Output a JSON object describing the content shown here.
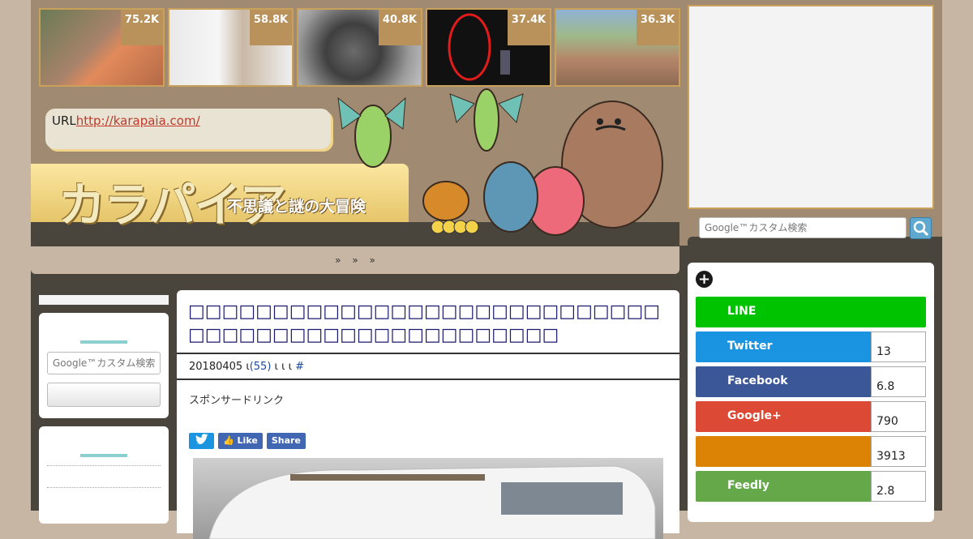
{
  "colors": {
    "twitter": "#1a93e0",
    "facebook": "#3b5797",
    "googleplus": "#dc4a36",
    "hatena": "#dc8205",
    "feedly": "#65a84a",
    "line": "#00c300",
    "title": "#1a1a6e"
  },
  "thumbs": [
    {
      "count": "75.2K"
    },
    {
      "count": "58.8K"
    },
    {
      "count": "40.8K"
    },
    {
      "count": "37.4K"
    },
    {
      "count": "36.3K"
    }
  ],
  "header": {
    "url_label": "URL",
    "url_link": "http://karapaia.com/",
    "logo_text": "カラパイア",
    "logo_sub": "不思議と謎の大冒険"
  },
  "nav": {
    "text": "» » »"
  },
  "search": {
    "placeholder": "Google™カスタム検索"
  },
  "article": {
    "title": "□□□□□□□□□□□□□□□□□□□□□□□□□□□□□□□□□□□□□□□□□□□□□□□□□□",
    "date": "20180405",
    "meta_a": "ι",
    "comments": "(55)",
    "meta_b": "ι ι ι",
    "hash": "#",
    "sponsor": "スポンサードリンク",
    "share_tweet": "",
    "share_like": "Like",
    "share_share": "Share"
  },
  "right_share": [
    {
      "name": "LINE",
      "count": ""
    },
    {
      "name": "Twitter",
      "count": "13"
    },
    {
      "name": "Facebook",
      "count": "6.8"
    },
    {
      "name": "Google+",
      "count": "790"
    },
    {
      "name": "",
      "count": "3913"
    },
    {
      "name": "Feedly",
      "count": "2.8"
    }
  ]
}
